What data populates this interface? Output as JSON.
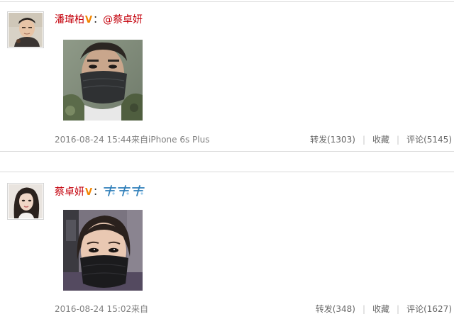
{
  "posts": [
    {
      "author": "潘瑋柏",
      "vip_badge": "V",
      "colon": "：",
      "content_mention": "@蔡卓妍",
      "timestamp": "2016-08-24 15:44",
      "source_label": "来自",
      "source_device": "iPhone 6s Plus",
      "actions": {
        "repost": "转发(1303)",
        "favorite": "收藏",
        "comment": "评论(5145)"
      },
      "avatar_icon": "avatar-man-photo",
      "image_icon": "man-wearing-black-mask-photo"
    },
    {
      "author": "蔡卓妍",
      "vip_badge": "V",
      "colon": "：",
      "content_emoji": "airplane-emoji-x3",
      "timestamp": "2016-08-24 15:02",
      "source_label": "来自",
      "source_device": "",
      "actions": {
        "repost": "转发(348)",
        "favorite": "收藏",
        "comment": "评论(1627)"
      },
      "avatar_icon": "avatar-woman-photo",
      "image_icon": "woman-wearing-black-mask-photo"
    }
  ],
  "separator": "|",
  "colors": {
    "nickname": "#c4000b",
    "vip": "#f28500",
    "meta_text": "#808080",
    "divider": "#d9d9d9"
  }
}
